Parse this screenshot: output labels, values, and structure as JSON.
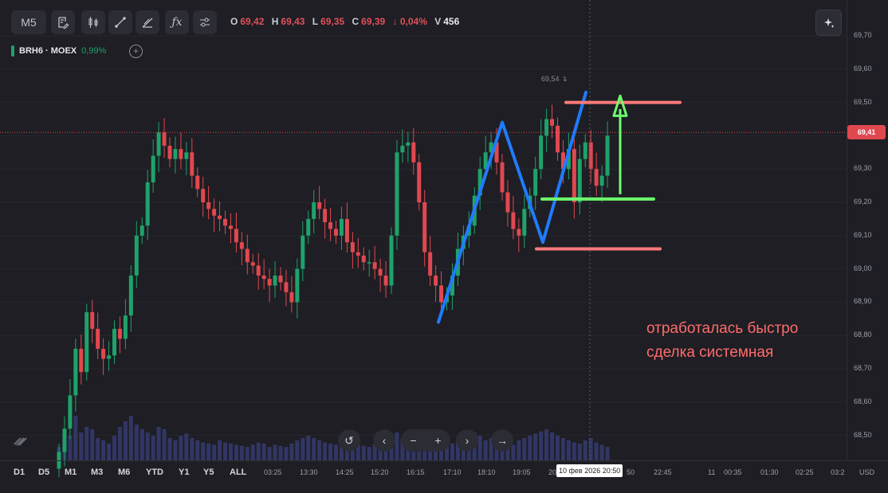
{
  "toolbar": {
    "interval": "M5",
    "ohlc": {
      "o_label": "O",
      "o": "69,42",
      "h_label": "H",
      "h": "69,43",
      "l_label": "L",
      "l": "69,35",
      "c_label": "C",
      "c": "69,39",
      "change": "↓ 0,04%",
      "v_label": "V",
      "v": "456"
    }
  },
  "icons": [
    "bookmark-edit-icon",
    "candles-icon",
    "line-tool-icon",
    "trend-tool-icon",
    "fx-icon",
    "settings-icon",
    "sparkle-icon",
    "plus-circle-icon"
  ],
  "instrument": {
    "name": "BRH6 · MOEX",
    "change": "0,99%"
  },
  "price_badge": "69,41",
  "hi_marker": "69,54 ↴",
  "periods": [
    "D1",
    "D5",
    "M1",
    "M3",
    "M6",
    "YTD",
    "Y1",
    "Y5",
    "ALL"
  ],
  "nav_buttons": {
    "reset": "↺",
    "left": "‹",
    "minus": "−",
    "plus": "+",
    "right": "›",
    "end": "→"
  },
  "crosshair_label": "10 фев 2026 20:50",
  "currency": "USD",
  "annotation": {
    "line1": "отработалась быстро",
    "line2": "сделка системная"
  },
  "colors": {
    "bg": "#1e1e24",
    "up": "#1fa26a",
    "down": "#e0484f",
    "volume": "#3a3f7a",
    "zigzag": "#1f7bff",
    "level": "#ff7a7a",
    "green_level": "#6dff6d"
  },
  "chart_data": {
    "type": "candlestick",
    "ylim": [
      68.42,
      69.74
    ],
    "yticks": [
      "69,70",
      "69,60",
      "69,50",
      "69,40",
      "69,30",
      "69,20",
      "69,10",
      "69,00",
      "68,90",
      "68,80",
      "68,70",
      "68,60",
      "68,50"
    ],
    "xticks": [
      "03:25",
      "13:30",
      "14:25",
      "15:20",
      "16:15",
      "17:10",
      "18:10",
      "19:05",
      "20",
      "22:45",
      "11",
      "00:35",
      "01:30",
      "02:25",
      "03:2"
    ],
    "close_series": [
      68.45,
      68.52,
      68.62,
      68.76,
      68.69,
      68.87,
      68.82,
      68.76,
      68.73,
      68.74,
      68.82,
      68.79,
      68.86,
      68.98,
      69.1,
      69.13,
      69.26,
      69.34,
      69.41,
      69.37,
      69.33,
      69.36,
      69.33,
      69.35,
      69.28,
      69.24,
      69.2,
      69.18,
      69.16,
      69.15,
      69.13,
      69.12,
      69.08,
      69.06,
      69.02,
      69.01,
      68.98,
      68.97,
      68.95,
      68.98,
      68.96,
      68.93,
      68.9,
      69.0,
      69.1,
      69.15,
      69.2,
      69.18,
      69.14,
      69.12,
      69.1,
      69.15,
      69.08,
      69.05,
      69.04,
      69.02,
      69.02,
      69.0,
      68.98,
      68.95,
      69.1,
      69.35,
      69.37,
      69.38,
      69.32,
      69.2,
      69.05,
      68.98,
      68.95,
      68.9,
      68.92,
      68.98,
      69.06,
      69.1,
      69.13,
      69.22,
      69.3,
      69.35,
      69.38,
      69.32,
      69.23,
      69.17,
      69.12,
      69.1,
      69.18,
      69.22,
      69.3,
      69.4,
      69.45,
      69.43,
      69.35,
      69.3,
      69.36,
      69.2,
      69.33,
      69.38,
      69.3,
      69.25,
      69.28,
      69.4
    ],
    "volume_series": [
      12,
      18,
      22,
      40,
      25,
      30,
      28,
      20,
      18,
      15,
      22,
      30,
      35,
      40,
      32,
      28,
      25,
      22,
      30,
      28,
      20,
      18,
      22,
      24,
      20,
      18,
      16,
      15,
      14,
      18,
      16,
      15,
      14,
      13,
      12,
      14,
      16,
      15,
      12,
      14,
      13,
      12,
      15,
      18,
      20,
      22,
      20,
      18,
      16,
      15,
      14,
      18,
      16,
      15,
      14,
      13,
      12,
      15,
      14,
      13,
      18,
      25,
      20,
      18,
      16,
      15,
      18,
      14,
      13,
      12,
      14,
      15,
      18,
      20,
      22,
      25,
      22,
      18,
      20,
      18,
      16,
      15,
      14,
      18,
      20,
      22,
      24,
      26,
      28,
      25,
      22,
      20,
      18,
      16,
      15,
      18,
      20,
      16,
      14,
      12
    ],
    "drawings": {
      "zigzag": [
        [
          68.84,
          "17:00"
        ],
        [
          69.44,
          "18:30"
        ],
        [
          69.08,
          "19:40"
        ],
        [
          69.53,
          "20:35"
        ]
      ],
      "resistance": 69.5,
      "support": 69.06,
      "entry": 69.21
    }
  }
}
